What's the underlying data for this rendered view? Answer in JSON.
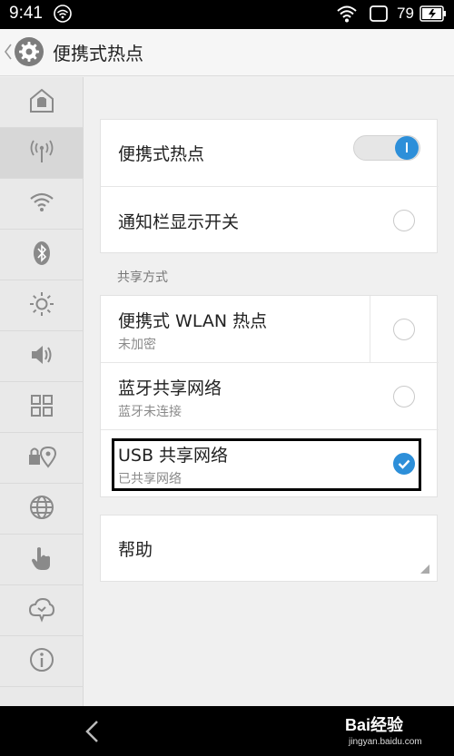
{
  "status_bar": {
    "time": "9:41",
    "battery": "79",
    "icons": [
      "wifi-outline-icon",
      "wifi-signal-icon",
      "square-icon",
      "battery-icon"
    ]
  },
  "title_bar": {
    "back_icon": "chevron-left-icon",
    "settings_icon": "gear-icon",
    "title": "便携式热点"
  },
  "sidebar": {
    "items": [
      {
        "icon": "home-icon"
      },
      {
        "icon": "hotspot-icon",
        "active": true
      },
      {
        "icon": "wifi-icon"
      },
      {
        "icon": "bluetooth-icon"
      },
      {
        "icon": "brightness-icon"
      },
      {
        "icon": "volume-icon"
      },
      {
        "icon": "grid-icon"
      },
      {
        "icon": "lock-location-icon"
      },
      {
        "icon": "globe-icon"
      },
      {
        "icon": "hand-icon"
      },
      {
        "icon": "cloud-icon"
      },
      {
        "icon": "info-icon"
      }
    ]
  },
  "main": {
    "hotspot": {
      "label": "便携式热点",
      "enabled": true
    },
    "notification_switch": {
      "label": "通知栏显示开关",
      "checked": false
    },
    "section_title": "共享方式",
    "sharing_methods": [
      {
        "label": "便携式 WLAN 热点",
        "sub": "未加密",
        "checked": false
      },
      {
        "label": "蓝牙共享网络",
        "sub": "蓝牙未连接",
        "checked": false
      },
      {
        "label": "USB 共享网络",
        "sub": "已共享网络",
        "checked": true
      }
    ],
    "help": {
      "label": "帮助"
    }
  },
  "nav_bar": {
    "back_icon": "back-arrow-icon",
    "watermark": "Bai经验",
    "watermark_url": "jingyan.baidu.com"
  },
  "colors": {
    "accent": "#2d8fd9",
    "highlight_border": "#000000"
  }
}
